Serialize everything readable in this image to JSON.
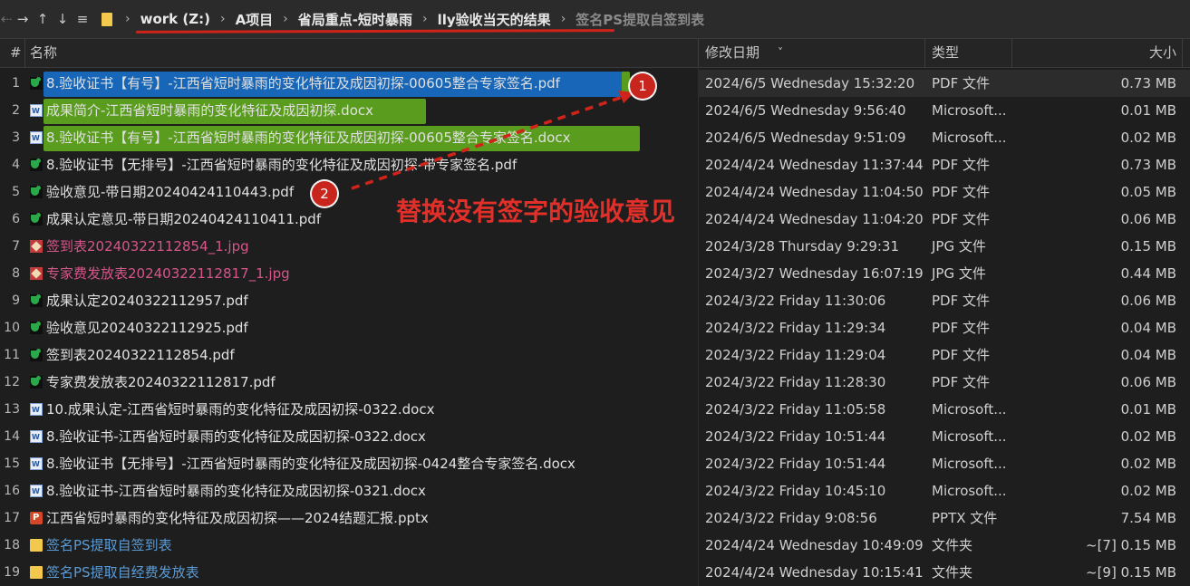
{
  "toolbar": {
    "back_icon": "arrow-left-icon",
    "forward_icon": "arrow-right-icon",
    "up_icon": "arrow-up-icon",
    "down_icon": "arrow-down-icon",
    "menu_icon": "hamburger-icon",
    "breadcrumb": [
      "work (Z:)",
      "A项目",
      "省局重点-短时暴雨",
      "lly验收当天的结果",
      "签名PS提取自签到表"
    ]
  },
  "columns": {
    "num": "#",
    "name": "名称",
    "date": "修改日期",
    "type": "类型",
    "size": "大小"
  },
  "files": [
    {
      "num": "1",
      "icon": "pdf",
      "name": "8.验收证书【有号】-江西省短时暴雨的变化特征及成因初探-00605整合专家签名.pdf",
      "date": "2024/6/5 Wednesday 15:32:20",
      "type": "PDF 文件",
      "size": "0.73 MB"
    },
    {
      "num": "2",
      "icon": "word",
      "name": "成果简介-江西省短时暴雨的变化特征及成因初探.docx",
      "date": "2024/6/5 Wednesday 9:56:40",
      "type": "Microsoft...",
      "size": "0.01 MB"
    },
    {
      "num": "3",
      "icon": "word",
      "name": "8.验收证书【有号】-江西省短时暴雨的变化特征及成因初探-00605整合专家签名.docx",
      "date": "2024/6/5 Wednesday 9:51:09",
      "type": "Microsoft...",
      "size": "0.02 MB"
    },
    {
      "num": "4",
      "icon": "pdf",
      "name": "8.验收证书【无排号】-江西省短时暴雨的变化特征及成因初探-带专家签名.pdf",
      "date": "2024/4/24 Wednesday 11:37:44",
      "type": "PDF 文件",
      "size": "0.73 MB"
    },
    {
      "num": "5",
      "icon": "pdf",
      "name": "验收意见-带日期20240424110443.pdf",
      "date": "2024/4/24 Wednesday 11:04:50",
      "type": "PDF 文件",
      "size": "0.05 MB"
    },
    {
      "num": "6",
      "icon": "pdf",
      "name": "成果认定意见-带日期20240424110411.pdf",
      "date": "2024/4/24 Wednesday 11:04:20",
      "type": "PDF 文件",
      "size": "0.06 MB"
    },
    {
      "num": "7",
      "icon": "jpg",
      "name": "签到表20240322112854_1.jpg",
      "date": "2024/3/28 Thursday 9:29:31",
      "type": "JPG 文件",
      "size": "0.15 MB"
    },
    {
      "num": "8",
      "icon": "jpg",
      "name": "专家费发放表20240322112817_1.jpg",
      "date": "2024/3/27 Wednesday 16:07:19",
      "type": "JPG 文件",
      "size": "0.44 MB"
    },
    {
      "num": "9",
      "icon": "pdf",
      "name": "成果认定20240322112957.pdf",
      "date": "2024/3/22 Friday 11:30:06",
      "type": "PDF 文件",
      "size": "0.06 MB"
    },
    {
      "num": "10",
      "icon": "pdf",
      "name": "验收意见20240322112925.pdf",
      "date": "2024/3/22 Friday 11:29:34",
      "type": "PDF 文件",
      "size": "0.04 MB"
    },
    {
      "num": "11",
      "icon": "pdf",
      "name": "签到表20240322112854.pdf",
      "date": "2024/3/22 Friday 11:29:04",
      "type": "PDF 文件",
      "size": "0.04 MB"
    },
    {
      "num": "12",
      "icon": "pdf",
      "name": "专家费发放表20240322112817.pdf",
      "date": "2024/3/22 Friday 11:28:30",
      "type": "PDF 文件",
      "size": "0.06 MB"
    },
    {
      "num": "13",
      "icon": "word",
      "name": "10.成果认定-江西省短时暴雨的变化特征及成因初探-0322.docx",
      "date": "2024/3/22 Friday 11:05:58",
      "type": "Microsoft...",
      "size": "0.01 MB"
    },
    {
      "num": "14",
      "icon": "word",
      "name": "8.验收证书-江西省短时暴雨的变化特征及成因初探-0322.docx",
      "date": "2024/3/22 Friday 10:51:44",
      "type": "Microsoft...",
      "size": "0.02 MB"
    },
    {
      "num": "15",
      "icon": "word",
      "name": "8.验收证书【无排号】-江西省短时暴雨的变化特征及成因初探-0424整合专家签名.docx",
      "date": "2024/3/22 Friday 10:51:44",
      "type": "Microsoft...",
      "size": "0.02 MB"
    },
    {
      "num": "16",
      "icon": "word",
      "name": "8.验收证书-江西省短时暴雨的变化特征及成因初探-0321.docx",
      "date": "2024/3/22 Friday 10:45:10",
      "type": "Microsoft...",
      "size": "0.02 MB"
    },
    {
      "num": "17",
      "icon": "ppt",
      "name": "江西省短时暴雨的变化特征及成因初探——2024结题汇报.pptx",
      "date": "2024/3/22 Friday 9:08:56",
      "type": "PPTX 文件",
      "size": "7.54 MB"
    },
    {
      "num": "18",
      "icon": "folder",
      "name": "签名PS提取自签到表",
      "date": "2024/4/24 Wednesday 10:49:09",
      "type": "文件夹",
      "size": "~[7]  0.15 MB"
    },
    {
      "num": "19",
      "icon": "folder",
      "name": "签名PS提取自经费发放表",
      "date": "2024/4/24 Wednesday 10:15:41",
      "type": "文件夹",
      "size": "~[9]  0.15 MB"
    }
  ],
  "annotations": {
    "badge1": "1",
    "badge2": "2",
    "note": "替换没有签字的验收意见"
  },
  "colors": {
    "selection_blue": "#1766b8",
    "highlight_green": "#5a9d1e",
    "annotation_red": "#e1302a"
  }
}
